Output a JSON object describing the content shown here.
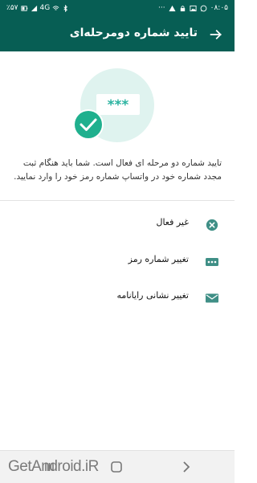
{
  "status_bar": {
    "time": "۰۸:۰۵",
    "battery": "٪۵۷",
    "network": "4G",
    "dots": "···"
  },
  "app_bar": {
    "title": "تایید شماره دومرحله‌ای"
  },
  "illustration": {
    "pin_mask": "***"
  },
  "description": "تایید شماره دو مرحله ای فعال است. شما باید هنگام ثبت مجدد شماره خود در واتساپ شماره رمز خود را وارد نمایید.",
  "options": [
    {
      "label": "غیر فعال",
      "icon": "disable-icon"
    },
    {
      "label": "تغییر شماره رمز",
      "icon": "pin-dots-icon"
    },
    {
      "label": "تغییر نشانی رایانامه",
      "icon": "email-icon"
    }
  ],
  "watermark": "GetAndroid.iR",
  "colors": {
    "primary": "#075e54",
    "accent": "#00a884",
    "icon": "#3f8f86",
    "illustration_bg": "#dff3ef"
  }
}
